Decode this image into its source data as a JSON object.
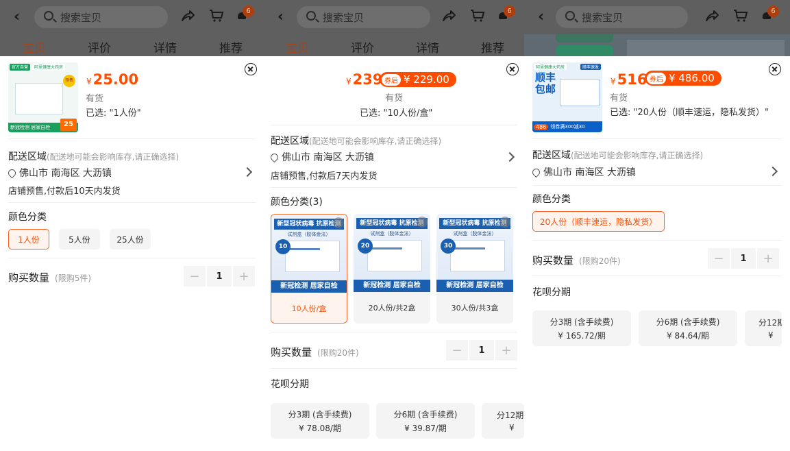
{
  "search_placeholder": "搜索宝贝",
  "cart_badge": "6",
  "tabs": [
    "宝贝",
    "评价",
    "详情",
    "推荐"
  ],
  "delivery": {
    "title": "配送区域",
    "hint": "(配送地可能会影响库存,请正确选择)",
    "location": "佛山市 南海区 大沥镇"
  },
  "panel1": {
    "price": "25.00",
    "stock": "有货",
    "selected": "已选: \"1人份\"",
    "ship_note": "店铺预售,付款后10天内发货",
    "color_title": "颜色分类",
    "options": [
      {
        "label": "1人份",
        "selected": true
      },
      {
        "label": "5人份",
        "selected": false
      },
      {
        "label": "25人份",
        "selected": false
      }
    ],
    "qty_title": "购买数量",
    "qty_limit": "(限购5件)",
    "qty": "1",
    "thumb": {
      "tag1": "官方自营",
      "tag2": "阿里健康大药房",
      "tag3": "预售",
      "foot": "新冠检测 居家自检",
      "promo": "25"
    }
  },
  "panel2": {
    "price": "239",
    "coupon_tag": "券后",
    "coupon_price": "¥ 229.00",
    "stock": "有货",
    "selected": "已选: \"10人份/盒\"",
    "ship_note": "店铺预售,付款后7天内发货",
    "color_title": "颜色分类(3)",
    "cards": [
      {
        "badge": "10",
        "label": "10人份/盒",
        "selected": true
      },
      {
        "badge": "20",
        "label": "20人份/共2盒",
        "selected": false
      },
      {
        "badge": "30",
        "label": "30人份/共3盒",
        "selected": false
      }
    ],
    "card_title": "新型冠状病毒 抗原检测",
    "card_sub": "试剂盒（胶体金法）",
    "card_foot": "新冠检测 居家自检",
    "qty_title": "购买数量",
    "qty_limit": "(限购20件)",
    "qty": "1",
    "installment_title": "花呗分期",
    "installments": [
      {
        "title": "分3期 (含手续费)",
        "price": "¥ 78.08/期"
      },
      {
        "title": "分6期 (含手续费)",
        "price": "¥ 39.87/期"
      },
      {
        "title": "分12期",
        "price": "¥"
      }
    ]
  },
  "panel3": {
    "price": "516",
    "coupon_tag": "券后",
    "coupon_price": "¥ 486.00",
    "stock": "有货",
    "selected": "已选: \"20人份（顺丰速运，隐私发货）\"",
    "color_title": "颜色分类",
    "option": "20人份（顺丰速运，隐私发货）",
    "qty_title": "购买数量",
    "qty_limit": "(限购20件)",
    "qty": "1",
    "installment_title": "花呗分期",
    "installments": [
      {
        "title": "分3期 (含手续费)",
        "price": "¥ 165.72/期"
      },
      {
        "title": "分6期 (含手续费)",
        "price": "¥ 84.64/期"
      },
      {
        "title": "分12期",
        "price": "¥"
      }
    ],
    "thumb": {
      "tag2": "阿里健康大药房",
      "tag3": "顺丰速发",
      "big": "顺丰包邮",
      "foot": "486",
      "promo": "领券满300减30"
    }
  },
  "colors": {
    "accent": "#ff4d00",
    "dim": "#5f5f5f",
    "brand_blue": "#1b5fb0"
  }
}
